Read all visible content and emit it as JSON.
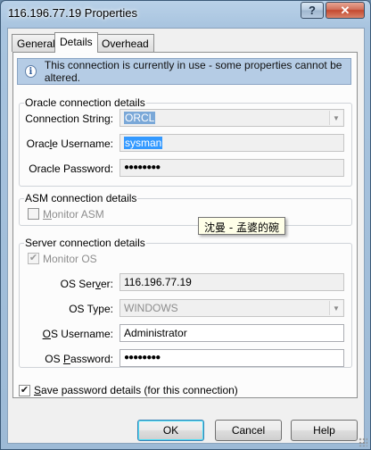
{
  "window": {
    "title": "116.196.77.19 Properties",
    "help_label": "?",
    "close_label": "✕"
  },
  "tabs": [
    {
      "label": "General"
    },
    {
      "label": "Details"
    },
    {
      "label": "Overhead"
    }
  ],
  "info": {
    "icon": "info-icon",
    "text": "This connection is currently in use - some properties cannot be altered."
  },
  "oracle": {
    "legend": "Oracle connection details",
    "connection_string_label_pre": "Connection Strin",
    "connection_string_label_u": "g",
    "connection_string_label_post": ":",
    "connection_string_value": "ORCL",
    "username_label_pre": "Orac",
    "username_label_u": "l",
    "username_label_post": "e Username:",
    "username_value": "sysman",
    "password_label": "Oracle Password:",
    "password_value": "●●●●●●●●"
  },
  "asm": {
    "legend": "ASM connection details",
    "monitor_label_pre": "",
    "monitor_label_u": "M",
    "monitor_label_post": "onitor ASM",
    "checked": false
  },
  "tooltip": {
    "text": "沈曼 - 孟婆的碗"
  },
  "server": {
    "legend": "Server connection details",
    "monitor_label": "Monitor OS",
    "checked": true,
    "os_server_label_pre": "OS Ser",
    "os_server_label_u": "v",
    "os_server_label_post": "er:",
    "os_server_value": "116.196.77.19",
    "os_type_label": "OS Type:",
    "os_type_value": "WINDOWS",
    "os_username_label_pre": "",
    "os_username_label_u": "O",
    "os_username_label_post": "S Username:",
    "os_username_value": "Administrator",
    "os_password_label_pre": "OS ",
    "os_password_label_u": "P",
    "os_password_label_post": "assword:",
    "os_password_value": "●●●●●●●●"
  },
  "save_password": {
    "label_pre": "",
    "label_u": "S",
    "label_post": "ave password details (for this connection)",
    "checked": true
  },
  "buttons": {
    "ok": "OK",
    "cancel": "Cancel",
    "help": "Help"
  }
}
